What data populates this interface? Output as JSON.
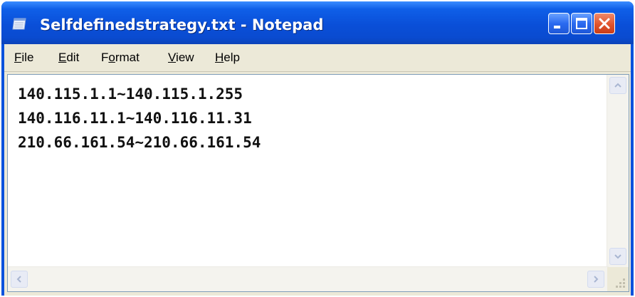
{
  "window": {
    "title": "Selfdefinedstrategy.txt - Notepad",
    "accent_color": "#0a52dd",
    "close_color": "#e0532c"
  },
  "menu": {
    "items": [
      {
        "accel": "F",
        "rest": "ile"
      },
      {
        "accel": "E",
        "rest": "dit"
      },
      {
        "pre": "F",
        "accel": "o",
        "rest": "rmat"
      },
      {
        "accel": "V",
        "rest": "iew"
      },
      {
        "accel": "H",
        "rest": "elp"
      }
    ]
  },
  "editor": {
    "lines": [
      "140.115.1.1~140.115.1.255",
      "140.116.11.1~140.116.11.31",
      "210.66.161.54~210.66.161.54"
    ]
  },
  "icons": {
    "app": "notepad-icon",
    "minimize": "minimize-icon",
    "maximize": "maximize-icon",
    "close": "close-icon",
    "scroll_up": "arrow-up-icon",
    "scroll_down": "arrow-down-icon",
    "scroll_left": "arrow-left-icon",
    "scroll_right": "arrow-right-icon",
    "grip": "resize-grip-icon"
  }
}
